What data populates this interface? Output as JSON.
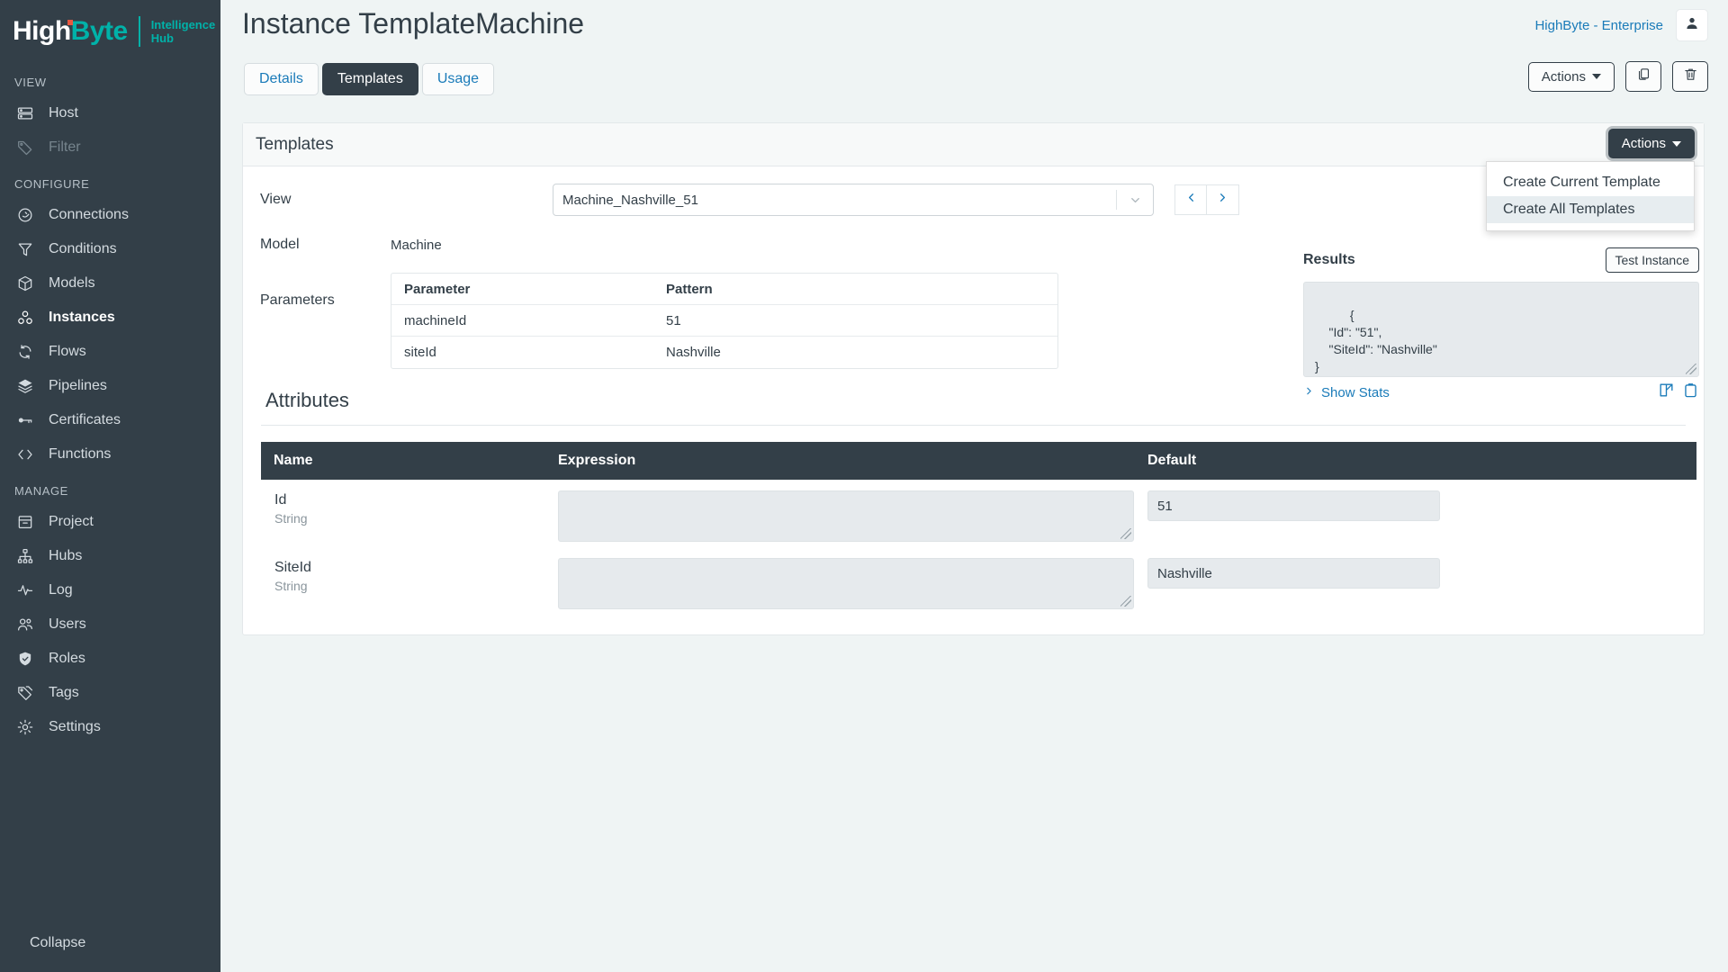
{
  "brand": {
    "high": "High",
    "byte": "Byte",
    "sub_line1": "Intelligence",
    "sub_line2": "Hub"
  },
  "sidebar": {
    "sections": [
      {
        "label": "VIEW",
        "items": [
          {
            "label": "Host",
            "icon": "server-icon",
            "state": "normal"
          },
          {
            "label": "Filter",
            "icon": "tag-icon",
            "state": "disabled"
          }
        ]
      },
      {
        "label": "CONFIGURE",
        "items": [
          {
            "label": "Connections",
            "icon": "plug-icon",
            "state": "normal"
          },
          {
            "label": "Conditions",
            "icon": "funnel-icon",
            "state": "normal"
          },
          {
            "label": "Models",
            "icon": "box-icon",
            "state": "normal"
          },
          {
            "label": "Instances",
            "icon": "instances-icon",
            "state": "active"
          },
          {
            "label": "Flows",
            "icon": "refresh-icon",
            "state": "normal"
          },
          {
            "label": "Pipelines",
            "icon": "layers-icon",
            "state": "normal"
          },
          {
            "label": "Certificates",
            "icon": "key-icon",
            "state": "normal"
          },
          {
            "label": "Functions",
            "icon": "code-icon",
            "state": "normal"
          }
        ]
      },
      {
        "label": "MANAGE",
        "items": [
          {
            "label": "Project",
            "icon": "archive-icon",
            "state": "normal"
          },
          {
            "label": "Hubs",
            "icon": "hubs-icon",
            "state": "normal"
          },
          {
            "label": "Log",
            "icon": "activity-icon",
            "state": "normal"
          },
          {
            "label": "Users",
            "icon": "users-icon",
            "state": "normal"
          },
          {
            "label": "Roles",
            "icon": "shield-check-icon",
            "state": "normal"
          },
          {
            "label": "Tags",
            "icon": "tags-icon",
            "state": "normal"
          },
          {
            "label": "Settings",
            "icon": "gear-icon",
            "state": "normal"
          }
        ]
      }
    ],
    "collapse_label": "Collapse",
    "collapse_icon": "collapse-left-icon"
  },
  "header": {
    "title": "Instance TemplateMachine",
    "tabs": [
      {
        "label": "Details",
        "active": false
      },
      {
        "label": "Templates",
        "active": true
      },
      {
        "label": "Usage",
        "active": false
      }
    ],
    "account_label": "HighByte - Enterprise",
    "avatar_icon": "user-icon",
    "actions_label": "Actions",
    "copy_icon": "copy-icon",
    "delete_icon": "trash-icon"
  },
  "card": {
    "title": "Templates",
    "actions_label": "Actions",
    "menu": [
      {
        "label": "Create Current Template",
        "highlighted": false
      },
      {
        "label": "Create All Templates",
        "highlighted": true
      }
    ],
    "view": {
      "label": "View",
      "value": "Machine_Nashville_51",
      "prev_icon": "chevron-left-icon",
      "next_icon": "chevron-right-icon",
      "dropdown_icon": "chevron-down-icon"
    },
    "model": {
      "label": "Model",
      "value": "Machine"
    },
    "parameters": {
      "label": "Parameters",
      "columns": [
        "Parameter",
        "Pattern"
      ],
      "rows": [
        {
          "parameter": "machineId",
          "pattern": "51"
        },
        {
          "parameter": "siteId",
          "pattern": "Nashville"
        }
      ]
    },
    "results": {
      "title": "Results",
      "test_button": "Test Instance",
      "body": "{\n    \"Id\": \"51\",\n    \"SiteId\": \"Nashville\"\n}",
      "show_stats": "Show Stats",
      "show_stats_icon": "chevron-right-icon",
      "open_icon": "external-link-icon",
      "copy_icon": "clipboard-icon"
    },
    "attributes": {
      "title": "Attributes",
      "columns": [
        "Name",
        "Expression",
        "Default"
      ],
      "rows": [
        {
          "name": "Id",
          "type": "String",
          "expression": "",
          "default": "51"
        },
        {
          "name": "SiteId",
          "type": "String",
          "expression": "",
          "default": "Nashville"
        }
      ]
    }
  },
  "colors": {
    "sidebar_bg": "#333f48",
    "page_bg": "#eff4f4",
    "brand_teal": "#00b2a9",
    "brand_dot": "#e8573f",
    "link_blue": "#1a7bb9",
    "input_bg": "#e6eaed"
  }
}
